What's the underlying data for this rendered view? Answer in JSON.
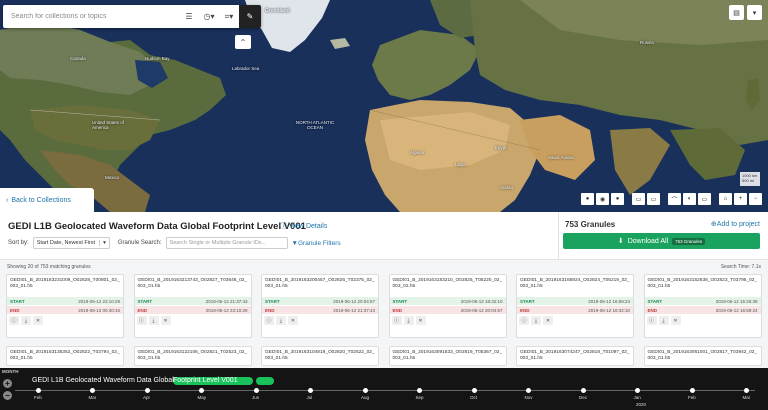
{
  "search": {
    "placeholder": "Search for collections or topics"
  },
  "map": {
    "labels": [
      "Greenland",
      "Canada",
      "Hudson Bay",
      "Labrador Sea",
      "United States of America",
      "Mexico",
      "NORTH ATLANTIC OCEAN",
      "Algeria",
      "Libya",
      "Egypt",
      "Saudi Arabia",
      "Sudan",
      "Russia"
    ],
    "scale": [
      "1000 km",
      "500 mi"
    ]
  },
  "panel": {
    "back_label": "Back to Collections",
    "title": "GEDI L1B Geolocated Waveform Data Global Footprint Level V001",
    "view_details": "View Details",
    "sort_by_label": "Sort by:",
    "sort_value": "Start Date, Newest First",
    "granule_search_label": "Granule Search:",
    "granule_search_placeholder": "Search Single or Multiple Granule IDs...",
    "granule_filters": "Granule Filters",
    "granule_count": "753 Granules",
    "add_to_project": "Add to project",
    "download_all": "Download All",
    "download_badge": "753 Granules",
    "showing": "Showing 20 of 753 matching granules",
    "search_time": "Search Time: 7.1s"
  },
  "granules": [
    {
      "name": "GEDI01_B_2019163231009_O02828_T00801_02_003_01.h5",
      "start": "2019-06-12 23:10:29",
      "end": "2019-06-13 00:40:15"
    },
    {
      "name": "GEDI01_B_2019163213743_O02827_T03646_02_003_01.h5",
      "start": "2019-06-12 21:37:43",
      "end": "2019-06-12 23:10:29"
    },
    {
      "name": "GEDI01_B_2019163200457_O02826_T02375_02_003_01.h5",
      "start": "2019-06-12 20:04:57",
      "end": "2019-06-12 21:37:43"
    },
    {
      "name": "GEDI01_B_2019163183210_O02825_T05220_02_003_02.h5",
      "start": "2019-06-12 18:32:10",
      "end": "2019-06-12 20:04:57"
    },
    {
      "name": "GEDI01_B_2019163165924_O02824_T05219_02_003_01.h5",
      "start": "2019-06-12 16:59:24",
      "end": "2019-06-12 18:32:10"
    },
    {
      "name": "GEDI01_B_2019163152638_O02823_T03795_02_003_01.h5",
      "start": "2019-06-12 15:26:38",
      "end": "2019-06-12 16:59:24"
    },
    {
      "name": "GEDI01_B_2019163135352_O02822_T03794_02_003_01.h5",
      "start": "",
      "end": ""
    },
    {
      "name": "GEDI01_B_2019163122106_O02821_T02523_02_003_01.h5",
      "start": "",
      "end": ""
    },
    {
      "name": "GEDI01_B_2019163104819_O02820_T02522_02_003_01.h5",
      "start": "",
      "end": ""
    },
    {
      "name": "GEDI01_B_2019163091533_O02819_T05367_02_003_01.h5",
      "start": "",
      "end": ""
    },
    {
      "name": "GEDI01_B_2019163074247_O02818_T01097_02_003_01.h5",
      "start": "",
      "end": ""
    },
    {
      "name": "GEDI01_B_2019163061001_O02817_T03942_02_003_01.h5",
      "start": "",
      "end": ""
    }
  ],
  "card_labels": {
    "start": "START",
    "end": "END"
  },
  "timeline": {
    "label": "MONTH",
    "title_part1": "GEDI L1B Geolocated Waveform Data Global",
    "title_part2": "Footprint Level V001",
    "months": [
      "Feb",
      "Mar",
      "Apr",
      "May",
      "Jun",
      "Jul",
      "Aug",
      "Sep",
      "Oct",
      "Nov",
      "Dec",
      "Jan",
      "Feb",
      "Mar"
    ],
    "year": "2020"
  },
  "colors": {
    "accent": "#2275aa",
    "download": "#1aa35e",
    "timeline_highlight": "#19c25a"
  }
}
